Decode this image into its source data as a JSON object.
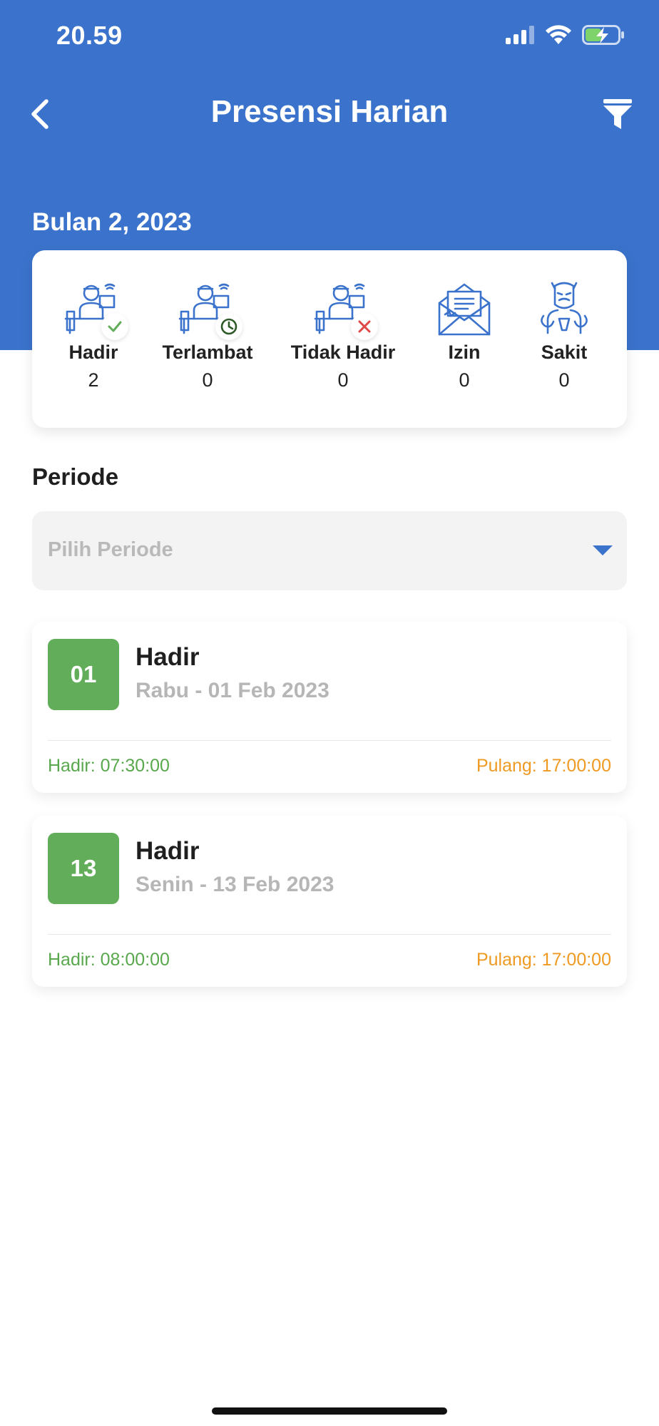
{
  "status_bar": {
    "time": "20.59"
  },
  "nav": {
    "title": "Presensi Harian"
  },
  "month_label": "Bulan 2, 2023",
  "summary": [
    {
      "label": "Hadir",
      "count": "2",
      "icon": "worker-desk-check-icon"
    },
    {
      "label": "Terlambat",
      "count": "0",
      "icon": "worker-desk-clock-icon"
    },
    {
      "label": "Tidak Hadir",
      "count": "0",
      "icon": "worker-desk-cross-icon"
    },
    {
      "label": "Izin",
      "count": "0",
      "icon": "envelope-letter-icon"
    },
    {
      "label": "Sakit",
      "count": "0",
      "icon": "sick-person-icon"
    }
  ],
  "periode": {
    "title": "Periode",
    "placeholder": "Pilih Periode"
  },
  "records": [
    {
      "day": "01",
      "status": "Hadir",
      "date": "Rabu - 01 Feb 2023",
      "checkin": "Hadir: 07:30:00",
      "checkout": "Pulang: 17:00:00"
    },
    {
      "day": "13",
      "status": "Hadir",
      "date": "Senin - 13 Feb 2023",
      "checkin": "Hadir: 08:00:00",
      "checkout": "Pulang: 17:00:00"
    }
  ],
  "colors": {
    "primary": "#3b73cc",
    "present": "#61ad5a",
    "checkin_text": "#5aa84e",
    "checkout_text": "#ef9a22",
    "late_badge": "#2e5a28",
    "absent_badge": "#e04848"
  }
}
